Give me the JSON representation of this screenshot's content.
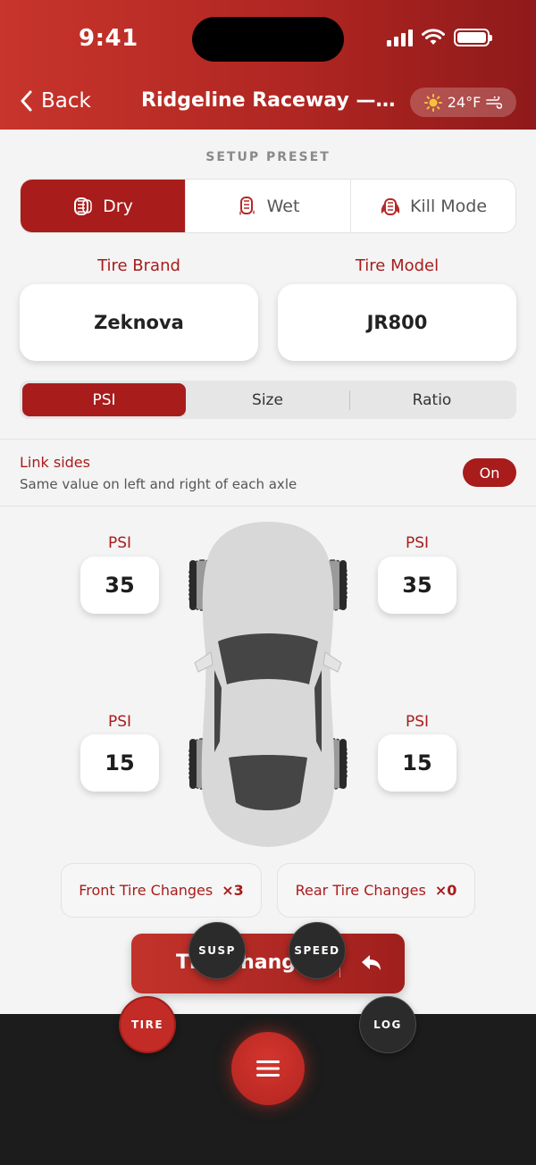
{
  "status": {
    "time": "9:41"
  },
  "nav": {
    "back_label": "Back",
    "title": "Ridgeline Raceway — Road Course",
    "weather_temp": "24°F"
  },
  "preset": {
    "label": "SETUP PRESET",
    "options": [
      {
        "label": "Dry",
        "icon": "tire-icon",
        "active": true
      },
      {
        "label": "Wet",
        "icon": "wet-tire-icon",
        "active": false
      },
      {
        "label": "Kill Mode",
        "icon": "fire-tire-icon",
        "active": false
      }
    ]
  },
  "tire": {
    "brand_label": "Tire Brand",
    "brand_value": "Zeknova",
    "model_label": "Tire Model",
    "model_value": "JR800"
  },
  "segment": {
    "options": [
      "PSI",
      "Size",
      "Ratio"
    ],
    "active": "PSI"
  },
  "link_sides": {
    "title": "Link sides",
    "subtitle": "Same value on left and right of each axle",
    "toggle_label": "On"
  },
  "pressures": {
    "front_left": {
      "label": "PSI",
      "value": "35"
    },
    "front_right": {
      "label": "PSI",
      "value": "35"
    },
    "rear_left": {
      "label": "PSI",
      "value": "15"
    },
    "rear_right": {
      "label": "PSI",
      "value": "15"
    }
  },
  "changes": {
    "front_label": "Front Tire Changes",
    "front_count": "×3",
    "rear_label": "Rear Tire Changes",
    "rear_count": "×0"
  },
  "action": {
    "label": "Tire Change"
  },
  "fabs": {
    "susp": "SUSP",
    "speed": "SPEED",
    "tire": "TIRE",
    "log": "LOG"
  },
  "colors": {
    "accent": "#a81c1c",
    "header_start": "#c7352c",
    "header_end": "#8f1a1a",
    "bottom_bar": "#1c1c1c"
  }
}
